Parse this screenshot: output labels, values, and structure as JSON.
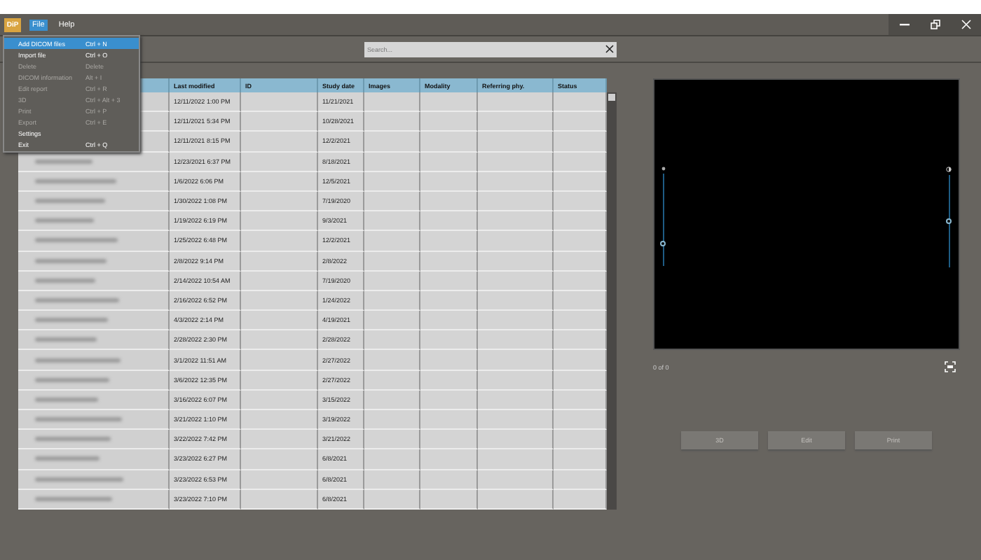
{
  "title_bar": {
    "logo": "DiP",
    "menus": [
      {
        "label": "File",
        "selected": true
      },
      {
        "label": "Help",
        "selected": false
      }
    ]
  },
  "file_menu": [
    {
      "label": "Add DICOM files",
      "shortcut": "Ctrl + N",
      "disabled": false,
      "selected": true
    },
    {
      "label": "Import file",
      "shortcut": "Ctrl + O",
      "disabled": false,
      "selected": false
    },
    {
      "label": "Delete",
      "shortcut": "Delete",
      "disabled": true,
      "selected": false
    },
    {
      "label": "DICOM information",
      "shortcut": "Alt + I",
      "disabled": true,
      "selected": false
    },
    {
      "label": "Edit report",
      "shortcut": "Ctrl + R",
      "disabled": true,
      "selected": false
    },
    {
      "label": "3D",
      "shortcut": "Ctrl + Alt + 3",
      "disabled": true,
      "selected": false
    },
    {
      "label": "Print",
      "shortcut": "Ctrl + P",
      "disabled": true,
      "selected": false
    },
    {
      "label": "Export",
      "shortcut": "Ctrl + E",
      "disabled": true,
      "selected": false
    },
    {
      "label": "Settings",
      "disabled": false,
      "selected": false
    },
    {
      "label": "Exit",
      "shortcut": "Ctrl + Q",
      "disabled": false,
      "selected": false
    }
  ],
  "search": {
    "placeholder": "Search..."
  },
  "table": {
    "columns": [
      "Last modified",
      "ID",
      "Study date",
      "Images",
      "Modality",
      "Referring phy.",
      "Status"
    ],
    "rows": [
      {
        "last_modified": "12/11/2022 1:00 PM",
        "study_date": "11/21/2021"
      },
      {
        "last_modified": "12/11/2021 5:34 PM",
        "study_date": "10/28/2021"
      },
      {
        "last_modified": "12/11/2021 8:15 PM",
        "study_date": "12/2/2021"
      },
      {
        "last_modified": "12/23/2021 6:37 PM",
        "study_date": "8/18/2021"
      },
      {
        "last_modified": "1/6/2022 6:06 PM",
        "study_date": "12/5/2021"
      },
      {
        "last_modified": "1/30/2022 1:08 PM",
        "study_date": "7/19/2020"
      },
      {
        "last_modified": "1/19/2022 6:19 PM",
        "study_date": "9/3/2021"
      },
      {
        "last_modified": "1/25/2022 6:48 PM",
        "study_date": "12/2/2021"
      },
      {
        "last_modified": "2/8/2022 9:14 PM",
        "study_date": "2/8/2022"
      },
      {
        "last_modified": "2/14/2022 10:54 AM",
        "study_date": "7/19/2020"
      },
      {
        "last_modified": "2/16/2022 6:52 PM",
        "study_date": "1/24/2022"
      },
      {
        "last_modified": "4/3/2022 2:14 PM",
        "study_date": "4/19/2021"
      },
      {
        "last_modified": "2/28/2022 2:30 PM",
        "study_date": "2/28/2022"
      },
      {
        "last_modified": "3/1/2022 11:51 AM",
        "study_date": "2/27/2022"
      },
      {
        "last_modified": "3/6/2022 12:35 PM",
        "study_date": "2/27/2022"
      },
      {
        "last_modified": "3/16/2022 6:07 PM",
        "study_date": "3/15/2022"
      },
      {
        "last_modified": "3/21/2022 1:10 PM",
        "study_date": "3/19/2022"
      },
      {
        "last_modified": "3/22/2022 7:42 PM",
        "study_date": "3/21/2022"
      },
      {
        "last_modified": "3/23/2022 6:27 PM",
        "study_date": "6/8/2021"
      },
      {
        "last_modified": "3/23/2022 6:53 PM",
        "study_date": "6/8/2021"
      },
      {
        "last_modified": "3/23/2022 7:10 PM",
        "study_date": "6/8/2021"
      }
    ]
  },
  "viewer": {
    "sliders": [
      {
        "level": 0.25
      },
      {
        "level": 0.5
      }
    ],
    "counter": "0 of 0"
  },
  "buttons": [
    {
      "label": "3D",
      "disabled": true
    },
    {
      "label": "Edit",
      "disabled": true
    },
    {
      "label": "Print",
      "disabled": true
    }
  ]
}
